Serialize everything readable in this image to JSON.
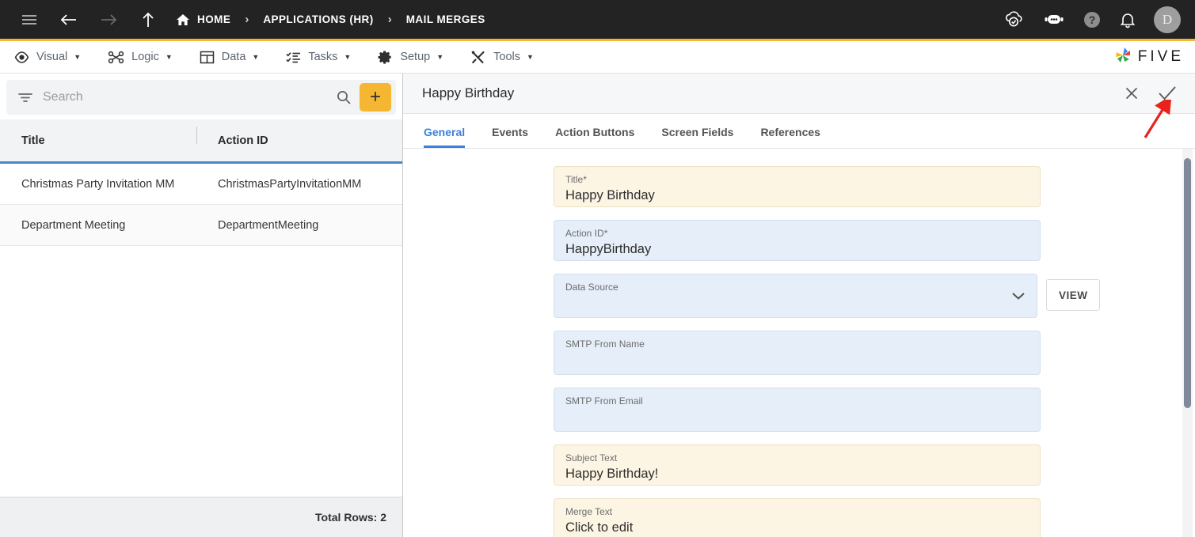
{
  "topbar": {
    "icons": [
      "hamburger-icon",
      "back-arrow-icon",
      "forward-arrow-icon",
      "up-arrow-icon"
    ],
    "breadcrumbs": [
      {
        "label": "HOME",
        "icon": "home-icon"
      },
      {
        "label": "APPLICATIONS (HR)",
        "icon": ""
      },
      {
        "label": "MAIL MERGES",
        "icon": ""
      }
    ],
    "separator": "›",
    "right_icons": [
      "cloud-check-icon",
      "robot-chat-icon",
      "help-icon",
      "bell-icon"
    ],
    "avatar_initial": "D"
  },
  "menubar": {
    "items": [
      {
        "label": "Visual",
        "icon": "eye-icon"
      },
      {
        "label": "Logic",
        "icon": "logic-nodes-icon"
      },
      {
        "label": "Data",
        "icon": "table-grid-icon"
      },
      {
        "label": "Tasks",
        "icon": "checklist-icon"
      },
      {
        "label": "Setup",
        "icon": "gear-icon"
      },
      {
        "label": "Tools",
        "icon": "tools-icon"
      }
    ],
    "caret": "▼",
    "logo_text": "FIVE"
  },
  "sidebar": {
    "search": {
      "placeholder": "Search",
      "value": ""
    },
    "filter_icon": "filter-icon",
    "search_icon": "search-icon",
    "add_label": "+",
    "table": {
      "columns": [
        "Title",
        "Action ID"
      ],
      "rows": [
        {
          "title": "Christmas Party Invitation MM",
          "action_id": "ChristmasPartyInvitationMM"
        },
        {
          "title": "Department Meeting",
          "action_id": "DepartmentMeeting"
        }
      ]
    },
    "footer": "Total Rows: 2"
  },
  "form": {
    "header_title": "Happy Birthday",
    "close_icon": "close-icon",
    "confirm_icon": "check-icon",
    "tabs": [
      {
        "label": "General",
        "active": true
      },
      {
        "label": "Events",
        "active": false
      },
      {
        "label": "Action Buttons",
        "active": false
      },
      {
        "label": "Screen Fields",
        "active": false
      },
      {
        "label": "References",
        "active": false
      }
    ],
    "fields": [
      {
        "label": "Title",
        "required": true,
        "value": "Happy Birthday",
        "style": "cream"
      },
      {
        "label": "Action ID",
        "required": true,
        "value": "HappyBirthday",
        "style": "blue"
      },
      {
        "label": "Data Source",
        "required": false,
        "value": "",
        "style": "blue",
        "control": "select",
        "button": "VIEW"
      },
      {
        "label": "SMTP From Name",
        "required": false,
        "value": "",
        "style": "blue"
      },
      {
        "label": "SMTP From Email",
        "required": false,
        "value": "",
        "style": "blue"
      },
      {
        "label": "Subject Text",
        "required": false,
        "value": "Happy Birthday!",
        "style": "cream"
      },
      {
        "label": "Merge Text",
        "required": false,
        "value": "Click to edit",
        "style": "cream"
      }
    ],
    "required_marker": "*",
    "chevron_icon": "chevron-down-icon"
  },
  "colors": {
    "topbar_bg": "#232323",
    "accent_yellow": "#f5b731",
    "tab_active_blue": "#3b82d6",
    "header_underline_blue": "#4a86c8",
    "field_cream": "#fdf5e4",
    "field_blue": "#e5eef9",
    "annotation_red": "#e8221c"
  },
  "annotation": {
    "type": "arrow",
    "points_to": "confirm-check-icon",
    "color": "#e8221c"
  }
}
